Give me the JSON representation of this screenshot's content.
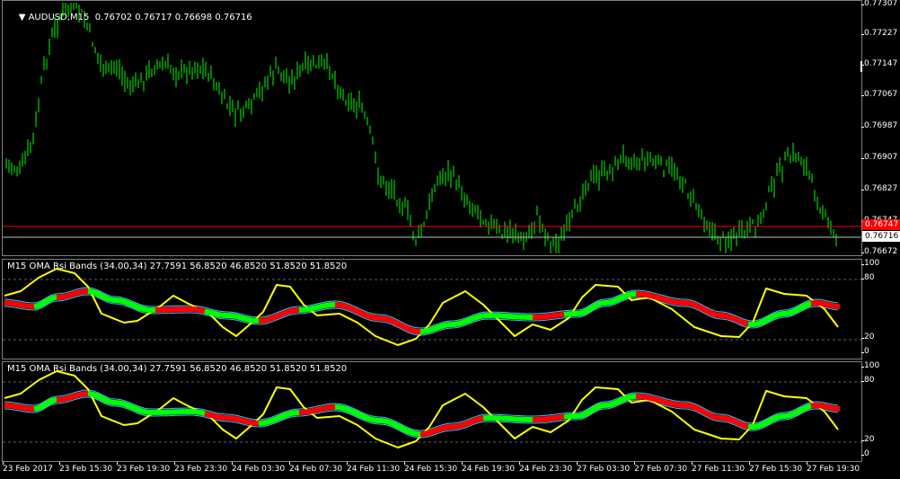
{
  "main_chart": {
    "title": "AUDUSD,M15",
    "ohlc": "0.76702 0.76717 0.76698 0.76716",
    "price_labels": [
      "0.77307",
      "0.77227",
      "0.77147",
      "0.77067",
      "0.76987",
      "0.76907",
      "0.76827",
      "0.76747",
      "0.76672"
    ],
    "red_line_price": "0.76747",
    "current_price": "0.76716"
  },
  "indicator1": {
    "title": "M15 OMA Rsi Bands (34.00,34) 27.7591 56.8520 46.8520 51.8520 51.8520",
    "levels": [
      "100",
      "80",
      "20",
      "0"
    ]
  },
  "indicator2": {
    "title": "M15 OMA Rsi Bands (34.00,34) 27.7591 56.8520 46.8520 51.8520 51.8520",
    "levels": [
      "100",
      "80",
      "20",
      "0"
    ]
  },
  "time_labels": [
    "23 Feb 2017",
    "23 Feb 15:30",
    "23 Feb 19:30",
    "23 Feb 23:30",
    "24 Feb 03:30",
    "24 Feb 07:30",
    "24 Feb 11:30",
    "24 Feb 15:30",
    "24 Feb 19:30",
    "24 Feb 23:30",
    "27 Feb 03:30",
    "27 Feb 07:30",
    "27 Feb 11:30",
    "27 Feb 15:30",
    "27 Feb 19:30"
  ],
  "colors": {
    "background": "#000000",
    "candle": "#00ff00",
    "price_line": "#ff0000",
    "rsi": "#ffff00",
    "band": "#40c0ff",
    "oma_up": "#00ff00",
    "oma_down": "#ff0000"
  }
}
